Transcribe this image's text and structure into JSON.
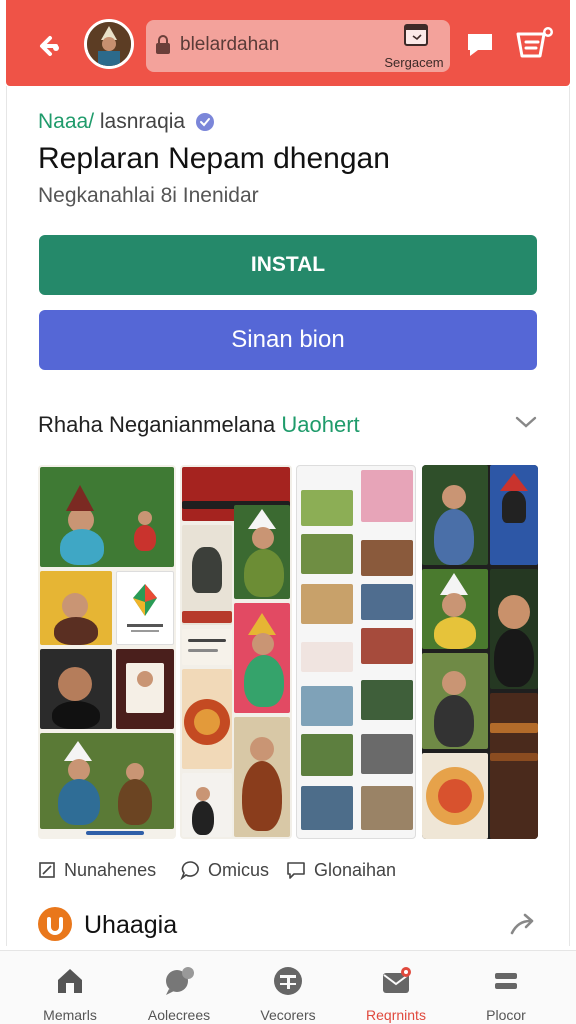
{
  "header": {
    "search": {
      "value": "blelardahan"
    },
    "search_button_label": "Sergacem"
  },
  "app": {
    "publisher_prefix": "Naaa/",
    "publisher_rest": " lasnraqia",
    "title": "Replaran Nepam dhengan",
    "subtitle": "Negkanahlai 8i Inenidar",
    "install_label": "INSTAL",
    "share_label": "Sinan bion"
  },
  "section": {
    "title_main": "Rhaha Neganianmelana ",
    "title_accent": "Uaohert"
  },
  "tabs": [
    {
      "label": "Nunahenes",
      "icon": "flag-icon"
    },
    {
      "label": "Omicus",
      "icon": "comment-icon"
    },
    {
      "label": "Glonaihan",
      "icon": "message-icon"
    }
  ],
  "related_app": {
    "name": "Uhaagia"
  },
  "bottom_nav": [
    {
      "label": "Memarls",
      "icon": "home-icon",
      "active": false
    },
    {
      "label": "Aolecrees",
      "icon": "chat-bubble-icon",
      "active": false
    },
    {
      "label": "Vecorers",
      "icon": "calendar-icon",
      "active": false
    },
    {
      "label": "Reqrnints",
      "icon": "mail-icon",
      "active": true
    },
    {
      "label": "Plocor",
      "icon": "menu-icon",
      "active": false
    }
  ],
  "colors": {
    "header": "#ef5347",
    "install": "#25896a",
    "share": "#5567d6",
    "accent_green": "#1f9b6b",
    "active_nav": "#e0493d"
  }
}
